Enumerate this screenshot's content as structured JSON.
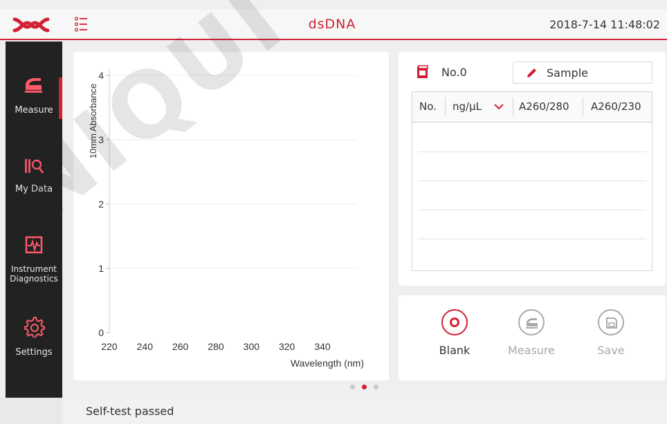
{
  "header": {
    "title": "dsDNA",
    "datetime": "2018-7-14  11:48:02"
  },
  "sidebar": {
    "items": [
      {
        "label": "Measure",
        "icon": "measure-icon",
        "active": true
      },
      {
        "label": "My Data",
        "icon": "my-data-icon",
        "active": false
      },
      {
        "label": "Instrument Diagnostics",
        "icon": "diagnostics-icon",
        "active": false
      },
      {
        "label": "Settings",
        "icon": "settings-icon",
        "active": false
      }
    ]
  },
  "chart_data": {
    "type": "line",
    "title": "",
    "xlabel": "Wavelength (nm)",
    "ylabel": "10mm Absorbance",
    "xlim": [
      220,
      350
    ],
    "ylim": [
      0,
      4
    ],
    "xticks": [
      "220",
      "240",
      "260",
      "280",
      "300",
      "320",
      "340"
    ],
    "yticks": [
      "0",
      "1",
      "2",
      "3",
      "4"
    ],
    "grid": true,
    "series": []
  },
  "pager": {
    "pages": 3,
    "active": 1
  },
  "sample": {
    "number": "No.0",
    "button_label": "Sample"
  },
  "results": {
    "columns": [
      "No.",
      "ng/µL",
      "A260/280",
      "A260/230"
    ],
    "rows": []
  },
  "actions": [
    {
      "label": "Blank",
      "enabled": true
    },
    {
      "label": "Measure",
      "enabled": false
    },
    {
      "label": "Save",
      "enabled": false
    }
  ],
  "status": {
    "text": "Self-test passed"
  },
  "watermark": {
    "text": "NIQUI"
  },
  "colors": {
    "accent": "#d11f33",
    "sidebar": "#222222",
    "panel": "#ffffff",
    "background": "#efefef",
    "disabled": "#a9a9a9"
  }
}
